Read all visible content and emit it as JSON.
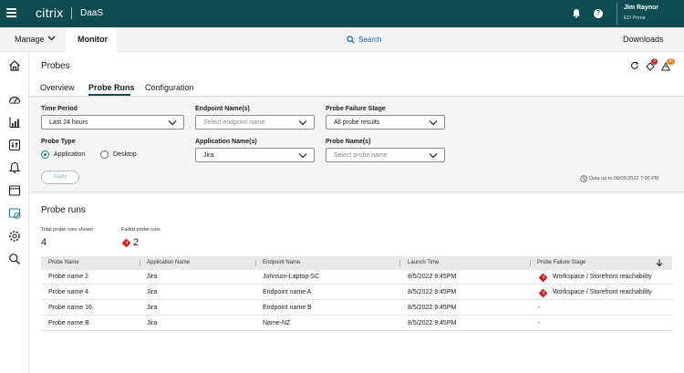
{
  "topbar": {
    "brand": "citrix",
    "product": "DaaS",
    "user_name": "Jim Raynor",
    "org": "EO Prime",
    "help": "?"
  },
  "navbar": {
    "manage": "Manage",
    "monitor": "Monitor",
    "search": "Search",
    "downloads": "Downloads"
  },
  "page": {
    "title": "Probes",
    "notifications": {
      "alerts_count": "3",
      "warnings_count": "10"
    },
    "tabs": [
      {
        "label": "Overview",
        "active": false
      },
      {
        "label": "Probe Runs",
        "active": true
      },
      {
        "label": "Configuration",
        "active": false
      }
    ]
  },
  "filters": {
    "time_period": {
      "label": "Time Period",
      "value": "Last 24 hours"
    },
    "endpoint_names": {
      "label": "Endpoint Name(s)",
      "placeholder": "Select endpoint name"
    },
    "failure_stage": {
      "label": "Probe Failure Stage",
      "value": "All probe results"
    },
    "probe_type": {
      "label": "Probe Type",
      "options": [
        "Application",
        "Desktop"
      ],
      "selected": "Application"
    },
    "application_names": {
      "label": "Application Name(s)",
      "value": "Jira"
    },
    "probe_names": {
      "label": "Probe Name(s)",
      "placeholder": "Select probe name"
    },
    "apply": "Apply",
    "data_note": "Data up to 08/05/2022 7:00 PM"
  },
  "probe_runs": {
    "title": "Probe runs",
    "total_label": "Total probe runs shown",
    "total_value": "4",
    "failed_label": "Failed probe runs",
    "failed_value": "2"
  },
  "table": {
    "columns": [
      "Probe Name",
      "Application Name",
      "Endpoint Name",
      "Launch Time",
      "Probe Failure Stage"
    ],
    "rows": [
      {
        "probe": "Probe name 2",
        "app": "Jira",
        "endpoint": "Johnson-Laptop-SC",
        "time": "8/5/2022 9:45PM",
        "stage": "Workspace / Storefront reachability",
        "failed": true
      },
      {
        "probe": "Probe name 4",
        "app": "Jira",
        "endpoint": "Endpoint name A",
        "time": "8/5/2022 9:45PM",
        "stage": "Workspace / Storefront reachability",
        "failed": true
      },
      {
        "probe": "Probe name 16",
        "app": "Jira",
        "endpoint": "Endpoint name B",
        "time": "8/5/2022 9:45PM",
        "stage": "-",
        "failed": false
      },
      {
        "probe": "Probe name B",
        "app": "Jira",
        "endpoint": "Name-NZ",
        "time": "8/5/2022 9:45PM",
        "stage": "-",
        "failed": false
      }
    ]
  },
  "colors": {
    "topbar": "#0f4c52",
    "accent": "#0f7c85",
    "error": "#d32020",
    "warning": "#e8821a",
    "link": "#1565c0"
  },
  "icons": [
    "menu-icon",
    "bell-icon",
    "help-icon",
    "chevron-down-icon",
    "search-icon",
    "home-icon",
    "gauge-icon",
    "analytics-icon",
    "filter-icon",
    "alerts-icon",
    "window-icon",
    "probe-icon",
    "settings-icon",
    "magnifier-icon",
    "refresh-icon",
    "alert-tag-icon",
    "warning-icon",
    "clock-icon",
    "sort-desc-icon",
    "error-diamond-icon"
  ]
}
